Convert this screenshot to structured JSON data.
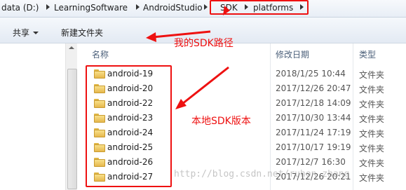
{
  "address_bar": {
    "crumbs": [
      "data (D:)",
      "LearningSoftware",
      "AndroidStudio",
      "SDK",
      "platforms"
    ]
  },
  "toolbar": {
    "share_label": "共享",
    "new_folder_label": "新建文件夹"
  },
  "columns": {
    "name": "名称",
    "date": "修改日期",
    "type": "类型"
  },
  "files": [
    {
      "name": "android-19",
      "date": "2018/1/25 10:44",
      "type": "文件夹"
    },
    {
      "name": "android-20",
      "date": "2017/12/26 20:47",
      "type": "文件夹"
    },
    {
      "name": "android-22",
      "date": "2017/12/18 14:09",
      "type": "文件夹"
    },
    {
      "name": "android-23",
      "date": "2017/10/30 13:44",
      "type": "文件夹"
    },
    {
      "name": "android-24",
      "date": "2017/11/24 17:19",
      "type": "文件夹"
    },
    {
      "name": "android-25",
      "date": "2017/10/17 19:19",
      "type": "文件夹"
    },
    {
      "name": "android-26",
      "date": "2017/12/7 16:30",
      "type": "文件夹"
    },
    {
      "name": "android-27",
      "date": "2017/12/26 20:21",
      "type": "文件夹"
    }
  ],
  "annotations": {
    "sdk_path": "我的SDK路径",
    "local_sdk_versions": "本地SDK版本"
  },
  "watermark": "http://blog.csdn.net/ruhon_zhang",
  "colors": {
    "annotation_red": "#ee1111",
    "folder_yellow": "#f0c85a"
  }
}
